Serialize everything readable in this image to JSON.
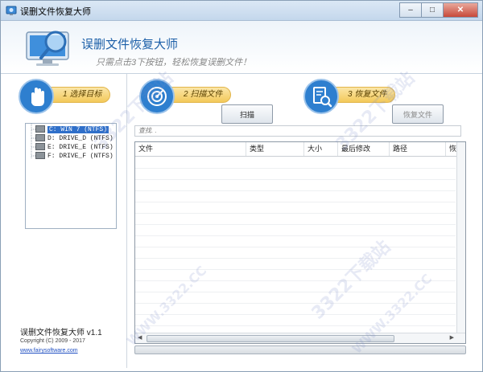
{
  "window": {
    "title": "误删文件恢复大师",
    "controls": {
      "minimize": "–",
      "maximize": "□",
      "close": "✕"
    }
  },
  "header": {
    "title": "误删文件恢复大师",
    "subtitle": "只需点击3下按钮，轻松恢复误删文件！"
  },
  "steps": [
    {
      "label": "1 选择目标",
      "icon": "hand-icon"
    },
    {
      "label": "2 扫描文件",
      "icon": "radar-icon"
    },
    {
      "label": "3 恢复文件",
      "icon": "document-search-icon"
    }
  ],
  "drives": [
    {
      "label": "C: WIN 7 (NTFS)",
      "selected": true
    },
    {
      "label": "D: DRIVE_D (NTFS)",
      "selected": false
    },
    {
      "label": "E: DRIVE_E (NTFS)",
      "selected": false
    },
    {
      "label": "F: DRIVE_F (NTFS)",
      "selected": false
    }
  ],
  "buttons": {
    "scan": "扫描",
    "recover": "恢复文件"
  },
  "search": {
    "placeholder": "查找. ."
  },
  "table": {
    "columns": [
      "文件",
      "类型",
      "大小",
      "最后修改",
      "路径",
      "恢复"
    ]
  },
  "footer": {
    "app_version": "误删文件恢复大师 v1.1",
    "copyright": "Copyright (C) 2009 - 2017",
    "website": "www.fairysoftware.com"
  },
  "watermark": "3322下载站",
  "watermark_url": "WWW.3322.CC",
  "colors": {
    "accent": "#1c5fa8",
    "step_pill": "#f3c95a",
    "step_circle": "#2e7fcf",
    "selection": "#2f6fc9"
  }
}
